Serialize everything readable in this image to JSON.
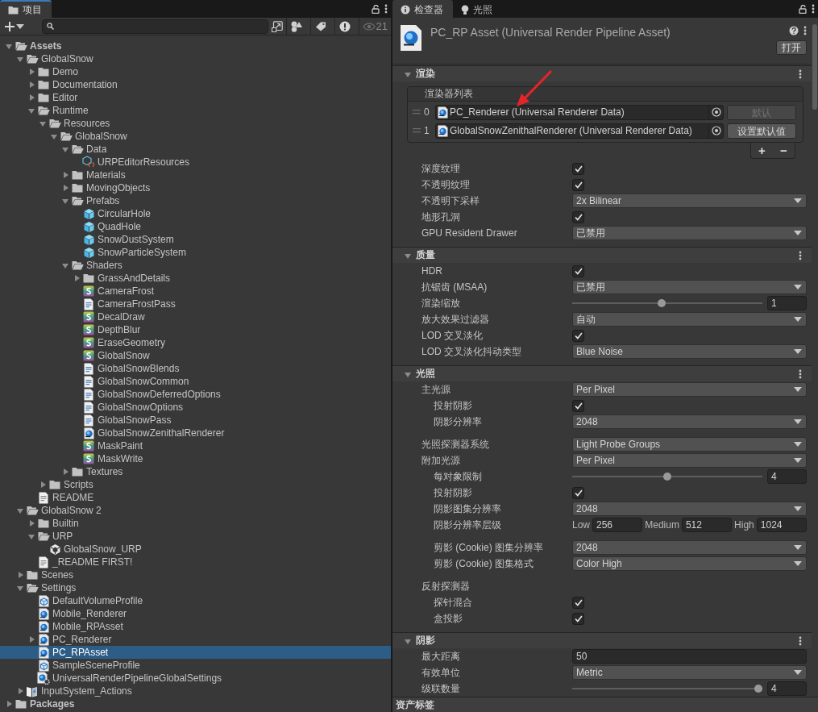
{
  "project": {
    "tab": "项目",
    "focused": true,
    "hidden_count": "21",
    "tree": [
      {
        "name": "Assets",
        "kind": "folder",
        "expanded": true,
        "selected": false,
        "children": [
          {
            "name": "GlobalSnow",
            "kind": "folder",
            "expanded": true,
            "selected": false,
            "children": [
              {
                "name": "Demo",
                "kind": "folder",
                "expanded": false,
                "selected": false
              },
              {
                "name": "Documentation",
                "kind": "folder",
                "expanded": false,
                "selected": false
              },
              {
                "name": "Editor",
                "kind": "folder",
                "expanded": false,
                "selected": false
              },
              {
                "name": "Runtime",
                "kind": "folder",
                "expanded": true,
                "selected": false,
                "children": [
                  {
                    "name": "Resources",
                    "kind": "folder",
                    "expanded": true,
                    "selected": false,
                    "children": [
                      {
                        "name": "GlobalSnow",
                        "kind": "folder",
                        "expanded": true,
                        "selected": false,
                        "children": [
                          {
                            "name": "Data",
                            "kind": "folder",
                            "expanded": true,
                            "selected": false,
                            "children": [
                              {
                                "name": "URPEditorResources",
                                "kind": "data",
                                "selected": false
                              }
                            ]
                          },
                          {
                            "name": "Materials",
                            "kind": "folder",
                            "expanded": false,
                            "selected": false
                          },
                          {
                            "name": "MovingObjects",
                            "kind": "folder",
                            "expanded": false,
                            "selected": false
                          },
                          {
                            "name": "Prefabs",
                            "kind": "folder",
                            "expanded": true,
                            "selected": false,
                            "children": [
                              {
                                "name": "CircularHole",
                                "kind": "prefab",
                                "selected": false
                              },
                              {
                                "name": "QuadHole",
                                "kind": "prefab",
                                "selected": false
                              },
                              {
                                "name": "SnowDustSystem",
                                "kind": "prefab",
                                "selected": false
                              },
                              {
                                "name": "SnowParticleSystem",
                                "kind": "prefab",
                                "selected": false
                              }
                            ]
                          },
                          {
                            "name": "Shaders",
                            "kind": "folder",
                            "expanded": true,
                            "selected": false,
                            "children": [
                              {
                                "name": "GrassAndDetails",
                                "kind": "folder",
                                "expanded": false,
                                "selected": false
                              },
                              {
                                "name": "CameraFrost",
                                "kind": "shader",
                                "selected": false
                              },
                              {
                                "name": "CameraFrostPass",
                                "kind": "text",
                                "selected": false
                              },
                              {
                                "name": "DecalDraw",
                                "kind": "shader",
                                "selected": false
                              },
                              {
                                "name": "DepthBlur",
                                "kind": "shader",
                                "selected": false
                              },
                              {
                                "name": "EraseGeometry",
                                "kind": "shader",
                                "selected": false
                              },
                              {
                                "name": "GlobalSnow",
                                "kind": "shader",
                                "selected": false
                              },
                              {
                                "name": "GlobalSnowBlends",
                                "kind": "text",
                                "selected": false
                              },
                              {
                                "name": "GlobalSnowCommon",
                                "kind": "text",
                                "selected": false
                              },
                              {
                                "name": "GlobalSnowDeferredOptions",
                                "kind": "text",
                                "selected": false
                              },
                              {
                                "name": "GlobalSnowOptions",
                                "kind": "text",
                                "selected": false
                              },
                              {
                                "name": "GlobalSnowPass",
                                "kind": "text",
                                "selected": false
                              },
                              {
                                "name": "GlobalSnowZenithalRenderer",
                                "kind": "rp",
                                "selected": false
                              },
                              {
                                "name": "MaskPaint",
                                "kind": "shader",
                                "selected": false
                              },
                              {
                                "name": "MaskWrite",
                                "kind": "shader",
                                "selected": false
                              }
                            ]
                          },
                          {
                            "name": "Textures",
                            "kind": "folder",
                            "expanded": false,
                            "selected": false
                          }
                        ]
                      }
                    ]
                  },
                  {
                    "name": "Scripts",
                    "kind": "folder",
                    "expanded": false,
                    "selected": false
                  }
                ]
              },
              {
                "name": "README",
                "kind": "readme",
                "selected": false
              }
            ]
          },
          {
            "name": "GlobalSnow 2",
            "kind": "folder",
            "expanded": true,
            "selected": false,
            "children": [
              {
                "name": "Builtin",
                "kind": "folder",
                "expanded": false,
                "selected": false
              },
              {
                "name": "URP",
                "kind": "folder",
                "expanded": true,
                "selected": false,
                "children": [
                  {
                    "name": "GlobalSnow_URP",
                    "kind": "unity",
                    "selected": false
                  }
                ]
              },
              {
                "name": "_README FIRST!",
                "kind": "readme",
                "selected": false
              }
            ]
          },
          {
            "name": "Scenes",
            "kind": "folder",
            "expanded": false,
            "selected": false
          },
          {
            "name": "Settings",
            "kind": "folder",
            "expanded": true,
            "selected": false,
            "children": [
              {
                "name": "DefaultVolumeProfile",
                "kind": "volume",
                "selected": false
              },
              {
                "name": "Mobile_Renderer",
                "kind": "rp",
                "selected": false
              },
              {
                "name": "Mobile_RPAsset",
                "kind": "rp",
                "selected": false
              },
              {
                "name": "PC_Renderer",
                "kind": "rp",
                "expanded": false,
                "selected": false
              },
              {
                "name": "PC_RPAsset",
                "kind": "rp",
                "selected": true
              },
              {
                "name": "SampleSceneProfile",
                "kind": "volume",
                "selected": false
              },
              {
                "name": "UniversalRenderPipelineGlobalSettings",
                "kind": "settings",
                "selected": false
              }
            ]
          },
          {
            "name": "InputSystem_Actions",
            "kind": "input",
            "expanded": false,
            "selected": false
          }
        ]
      },
      {
        "name": "Packages",
        "kind": "folder",
        "expanded": false,
        "selected": false
      }
    ]
  },
  "inspector": {
    "focused": false,
    "tabs": [
      {
        "label": "检查器",
        "kind": "info",
        "selected": true
      },
      {
        "label": "光照",
        "kind": "light",
        "selected": false
      }
    ],
    "title": "PC_RP Asset (Universal Render Pipeline Asset)",
    "open_button": "打开",
    "sections": [
      {
        "title": "渲染",
        "expanded": true,
        "renderer_list": {
          "title": "渲染器列表",
          "add": "+",
          "remove": "−",
          "items": [
            {
              "index": "0",
              "name": "PC_Renderer (Universal Renderer Data)",
              "button": "默认",
              "is_default": true
            },
            {
              "index": "1",
              "name": "GlobalSnowZenithalRenderer (Universal Renderer Data)",
              "button": "设置默认值",
              "is_default": false
            }
          ]
        },
        "groups": [
          [
            {
              "label": "深度纹理",
              "kind": "checkbox",
              "checked": true
            },
            {
              "label": "不透明纹理",
              "kind": "checkbox",
              "checked": true
            },
            {
              "label": "不透明下采样",
              "kind": "dropdown",
              "value": "2x Bilinear"
            },
            {
              "label": "地形孔洞",
              "kind": "checkbox",
              "checked": true
            },
            {
              "label": "GPU Resident Drawer",
              "kind": "dropdown",
              "value": "已禁用"
            }
          ]
        ]
      },
      {
        "title": "质量",
        "expanded": true,
        "groups": [
          [
            {
              "label": "HDR",
              "kind": "checkbox",
              "checked": true
            },
            {
              "label": "抗锯齿 (MSAA)",
              "kind": "dropdown",
              "value": "已禁用"
            },
            {
              "label": "渲染缩放",
              "kind": "slider",
              "level": 0.47,
              "value": "1"
            },
            {
              "label": "放大效果过滤器",
              "kind": "dropdown",
              "value": "自动"
            },
            {
              "label": "LOD 交叉淡化",
              "kind": "checkbox",
              "checked": true
            },
            {
              "label": "LOD 交叉淡化抖动类型",
              "kind": "dropdown",
              "value": "Blue Noise"
            }
          ]
        ]
      },
      {
        "title": "光照",
        "expanded": true,
        "groups": [
          [
            {
              "label": "主光源",
              "kind": "dropdown",
              "value": "Per Pixel",
              "groups": [
                [
                  {
                    "label": "投射阴影",
                    "kind": "checkbox",
                    "checked": true
                  },
                  {
                    "label": "阴影分辨率",
                    "kind": "dropdown",
                    "value": "2048"
                  }
                ]
              ]
            }
          ],
          [
            {
              "label": "光照探测器系统",
              "kind": "dropdown",
              "value": "Light Probe Groups"
            },
            {
              "label": "附加光源",
              "kind": "dropdown",
              "value": "Per Pixel",
              "groups": [
                [
                  {
                    "label": "每对象限制",
                    "kind": "slider",
                    "level": 0.5,
                    "value": "4"
                  },
                  {
                    "label": "投射阴影",
                    "kind": "checkbox",
                    "checked": true
                  },
                  {
                    "label": "阴影图集分辨率",
                    "kind": "dropdown",
                    "value": "2048"
                  },
                  {
                    "label": "阴影分辨率层级",
                    "kind": "tiers",
                    "tiers": [
                      {
                        "label": "Low",
                        "value": "256"
                      },
                      {
                        "label": "Medium",
                        "value": "512"
                      },
                      {
                        "label": "High",
                        "value": "1024"
                      }
                    ]
                  }
                ],
                [
                  {
                    "label": "剪影 (Cookie) 图集分辨率",
                    "kind": "dropdown",
                    "value": "2048"
                  },
                  {
                    "label": "剪影 (Cookie) 图集格式",
                    "kind": "dropdown",
                    "value": "Color High"
                  }
                ]
              ]
            }
          ],
          [
            {
              "label": "反射探测器",
              "kind": "heading",
              "groups": [
                [
                  {
                    "label": "探针混合",
                    "kind": "checkbox",
                    "checked": true
                  },
                  {
                    "label": "盒投影",
                    "kind": "checkbox",
                    "checked": true
                  }
                ]
              ]
            }
          ]
        ]
      },
      {
        "title": "阴影",
        "expanded": true,
        "groups": [
          [
            {
              "label": "最大距离",
              "kind": "number",
              "value": "50"
            },
            {
              "label": "有效单位",
              "kind": "dropdown",
              "value": "Metric"
            },
            {
              "label": "级联数量",
              "kind": "slider",
              "level": 0.98,
              "value": "4"
            }
          ]
        ]
      }
    ],
    "footer": "资产标签"
  }
}
